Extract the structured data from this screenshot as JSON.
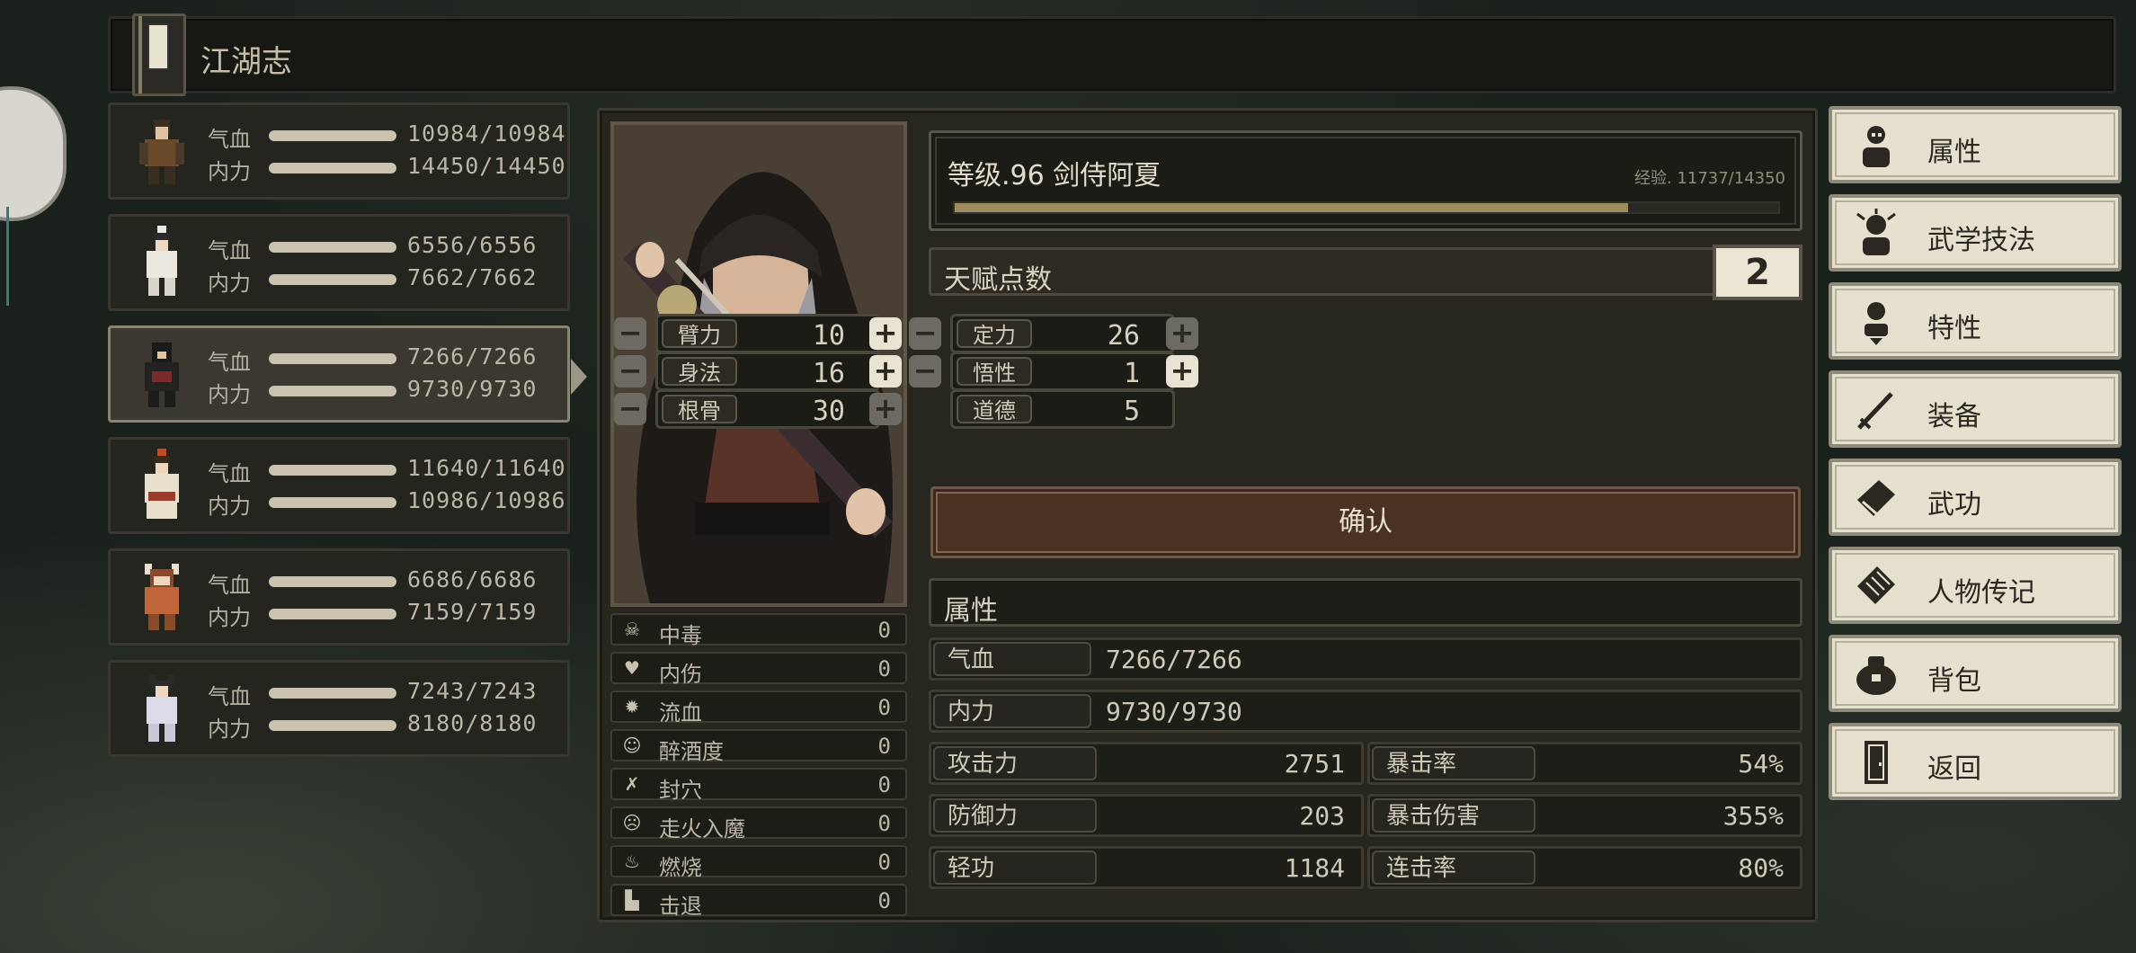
{
  "title": "江湖志",
  "party": [
    {
      "hp_label": "气血",
      "mp_label": "内力",
      "hp": "10984/10984",
      "mp": "14450/14450",
      "selected": false
    },
    {
      "hp_label": "气血",
      "mp_label": "内力",
      "hp": "6556/6556",
      "mp": "7662/7662",
      "selected": false
    },
    {
      "hp_label": "气血",
      "mp_label": "内力",
      "hp": "7266/7266",
      "mp": "9730/9730",
      "selected": true
    },
    {
      "hp_label": "气血",
      "mp_label": "内力",
      "hp": "11640/11640",
      "mp": "10986/10986",
      "selected": false
    },
    {
      "hp_label": "气血",
      "mp_label": "内力",
      "hp": "6686/6686",
      "mp": "7159/7159",
      "selected": false
    },
    {
      "hp_label": "气血",
      "mp_label": "内力",
      "hp": "7243/7243",
      "mp": "8180/8180",
      "selected": false
    }
  ],
  "character": {
    "level_text": "等级.96  剑侍阿夏",
    "exp_text": "经验. 11737/14350",
    "exp_progress": 0.818
  },
  "talent": {
    "label": "天赋点数",
    "value": "2"
  },
  "attributes": {
    "bili": {
      "label": "臂力",
      "value": "10"
    },
    "dingli": {
      "label": "定力",
      "value": "26"
    },
    "shenfa": {
      "label": "身法",
      "value": "16"
    },
    "wuxing": {
      "label": "悟性",
      "value": "1"
    },
    "gengu": {
      "label": "根骨",
      "value": "30"
    },
    "daode": {
      "label": "道德",
      "value": "5"
    }
  },
  "confirm_label": "确认",
  "props_title": "属性",
  "props": {
    "hp": {
      "label": "气血",
      "value": "7266/7266"
    },
    "mp": {
      "label": "内力",
      "value": "9730/9730"
    },
    "attack": {
      "label": "攻击力",
      "value": "2751"
    },
    "crit": {
      "label": "暴击率",
      "value": "54%"
    },
    "defense": {
      "label": "防御力",
      "value": "203"
    },
    "critdmg": {
      "label": "暴击伤害",
      "value": "355%"
    },
    "qinggong": {
      "label": "轻功",
      "value": "1184"
    },
    "combo": {
      "label": "连击率",
      "value": "80%"
    }
  },
  "statuses": [
    {
      "name": "中毒",
      "value": "0",
      "icon": "skull-icon"
    },
    {
      "name": "内伤",
      "value": "0",
      "icon": "broken-heart-icon"
    },
    {
      "name": "流血",
      "value": "0",
      "icon": "blood-icon"
    },
    {
      "name": "醉酒度",
      "value": "0",
      "icon": "drunk-face-icon"
    },
    {
      "name": "封穴",
      "value": "0",
      "icon": "sealed-icon"
    },
    {
      "name": "走火入魔",
      "value": "0",
      "icon": "demon-face-icon"
    },
    {
      "name": "燃烧",
      "value": "0",
      "icon": "fire-icon"
    },
    {
      "name": "击退",
      "value": "0",
      "icon": "boot-icon"
    }
  ],
  "menu": [
    {
      "label": "属性",
      "icon": "character-icon"
    },
    {
      "label": "武学技法",
      "icon": "martial-arts-icon"
    },
    {
      "label": "特性",
      "icon": "trait-icon"
    },
    {
      "label": "装备",
      "icon": "sword-icon"
    },
    {
      "label": "武功",
      "icon": "manual-book-icon"
    },
    {
      "label": "人物传记",
      "icon": "scroll-icon"
    },
    {
      "label": "背包",
      "icon": "bag-icon"
    },
    {
      "label": "返回",
      "icon": "door-icon"
    }
  ],
  "colors": {
    "accent": "#9c8c5e",
    "menu_bg": "#e6e1cf",
    "confirm_bg": "#4a3223"
  }
}
